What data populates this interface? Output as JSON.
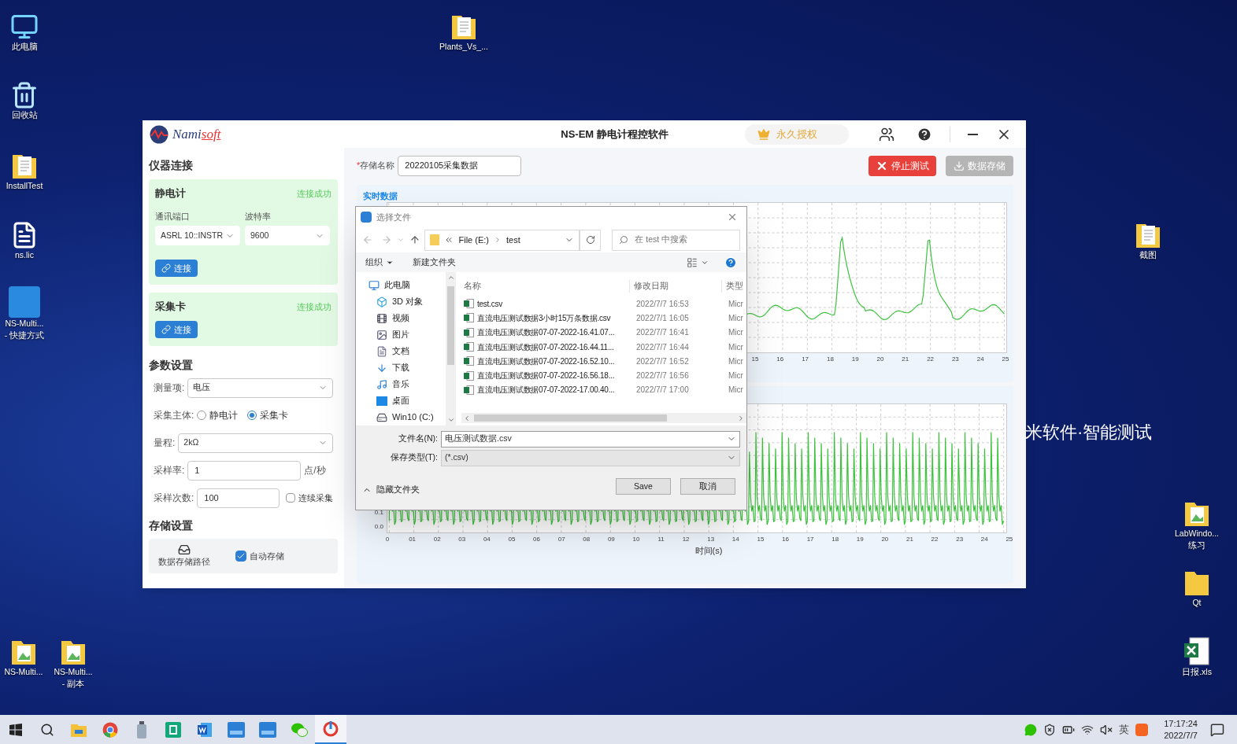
{
  "desktop": {
    "wallpaper_text": "米软件·智能测试",
    "icons": [
      {
        "kind": "computer",
        "lines": [
          "此电脑"
        ]
      },
      {
        "kind": "recycle-bin",
        "lines": [
          "回收站"
        ]
      },
      {
        "kind": "folder-doc",
        "lines": [
          "InstallTest"
        ]
      },
      {
        "kind": "document",
        "lines": [
          "ns.lic"
        ]
      },
      {
        "kind": "meter-app",
        "lines": [
          "NS-Multi...",
          "- 快捷方式"
        ]
      },
      {
        "kind": "folder-image",
        "lines": [
          "NS-Multi..."
        ]
      },
      {
        "kind": "folder-image",
        "lines": [
          "NS-Multi...",
          "- 副本"
        ]
      },
      {
        "kind": "folder-doc",
        "lines": [
          "Plants_Vs_..."
        ]
      },
      {
        "kind": "folder-doc",
        "lines": [
          "截图"
        ]
      },
      {
        "kind": "folder-image",
        "lines": [
          "LabWindo...",
          "练习"
        ]
      },
      {
        "kind": "folder",
        "lines": [
          "Qt"
        ]
      },
      {
        "kind": "excel",
        "lines": [
          "日报.xls"
        ]
      }
    ]
  },
  "app": {
    "logo": {
      "primary": "Nami",
      "accent": "soft"
    },
    "title": "NS-EM 静电计程控软件",
    "license": "永久授权",
    "sidebar": {
      "connection": {
        "heading": "仪器连接",
        "devices": [
          {
            "name": "静电计",
            "status": "连接成功",
            "connected": true,
            "fields": [
              {
                "label": "通讯端口",
                "value": "ASRL 10::INSTR"
              },
              {
                "label": "波特率",
                "value": "9600"
              }
            ],
            "button": "连接"
          },
          {
            "name": "采集卡",
            "status": "连接成功",
            "connected": true,
            "button": "连接"
          }
        ]
      },
      "params": {
        "heading": "参数设置",
        "rows": [
          {
            "kind": "select",
            "label": "测量项:",
            "value": "电压"
          },
          {
            "kind": "radio",
            "label": "采集主体:",
            "options": [
              {
                "label": "静电计",
                "selected": false
              },
              {
                "label": "采集卡",
                "selected": true
              }
            ]
          },
          {
            "kind": "select",
            "label": "量程:",
            "value": "2kΩ"
          },
          {
            "kind": "input",
            "label": "采样率:",
            "value": "1",
            "suffix": "点/秒"
          },
          {
            "kind": "input-check",
            "label": "采样次数:",
            "value": "100",
            "check": {
              "label": "连续采集",
              "checked": false
            }
          }
        ]
      },
      "storage": {
        "heading": "存储设置",
        "path_button": "数据存储路径",
        "auto": {
          "label": "自动存储",
          "checked": true
        }
      }
    },
    "main": {
      "name_field": {
        "required_mark": "*",
        "label": "存储名称",
        "value": "20220105采集数据"
      },
      "buttons": [
        {
          "kind": "stop",
          "label": "停止测试",
          "disabled": false
        },
        {
          "kind": "save",
          "label": "数据存储",
          "disabled": true
        }
      ],
      "charts": [
        {
          "title": "实时数据",
          "kind": "peaks",
          "x_tick_labels": [
            "15",
            "16",
            "17",
            "18",
            "19",
            "20",
            "21",
            "22",
            "23",
            "24",
            "25"
          ]
        },
        {
          "kind": "pulses",
          "x_tick_labels": [
            "0",
            "01",
            "02",
            "03",
            "04",
            "05",
            "06",
            "07",
            "08",
            "09",
            "10",
            "11",
            "12",
            "13",
            "14",
            "15",
            "16",
            "17",
            "18",
            "19",
            "20",
            "21",
            "22",
            "23",
            "24",
            "25"
          ],
          "y_tick_labels": [
            "0.1",
            "0.0"
          ],
          "xlabel": "时间(s)"
        }
      ]
    }
  },
  "dialog": {
    "title": "选择文件",
    "path": [
      "File (E:)",
      "test"
    ],
    "search_placeholder": "在 test 中搜索",
    "toolbar": [
      "组织",
      "新建文件夹"
    ],
    "tree": [
      {
        "label": "此电脑",
        "kind": "computer",
        "children": [
          {
            "label": "3D 对象",
            "kind": "cube"
          },
          {
            "label": "视频",
            "kind": "video"
          },
          {
            "label": "图片",
            "kind": "image"
          },
          {
            "label": "文档",
            "kind": "document"
          },
          {
            "label": "下载",
            "kind": "download"
          },
          {
            "label": "音乐",
            "kind": "music"
          },
          {
            "label": "桌面",
            "kind": "desktop"
          },
          {
            "label": "Win10 (C:)",
            "kind": "drive"
          }
        ]
      }
    ],
    "columns": [
      "名称",
      "修改日期",
      "类型"
    ],
    "files": [
      {
        "name": "test.csv",
        "date": "2022/7/7 16:53",
        "type": "Micr"
      },
      {
        "name": "直流电压测试数据3小时15万条数据.csv",
        "date": "2022/7/1 16:05",
        "type": "Micr"
      },
      {
        "name": "直流电压测试数据07-07-2022-16.41.07...",
        "date": "2022/7/7 16:41",
        "type": "Micr"
      },
      {
        "name": "直流电压测试数据07-07-2022-16.44.11...",
        "date": "2022/7/7 16:44",
        "type": "Micr"
      },
      {
        "name": "直流电压测试数据07-07-2022-16.52.10...",
        "date": "2022/7/7 16:52",
        "type": "Micr"
      },
      {
        "name": "直流电压测试数据07-07-2022-16.56.18...",
        "date": "2022/7/7 16:56",
        "type": "Micr"
      },
      {
        "name": "直流电压测试数据07-07-2022-17.00.40...",
        "date": "2022/7/7 17:00",
        "type": "Micr"
      }
    ],
    "filename": {
      "label": "文件名(N):",
      "value": "电压测试数据.csv"
    },
    "filetype": {
      "label": "保存类型(T):",
      "value": "(*.csv)"
    },
    "hide_folders": "隐藏文件夹",
    "buttons": [
      "Save",
      "取消"
    ]
  },
  "taskbar": {
    "items": [
      {
        "kind": "start",
        "active": false
      },
      {
        "kind": "search",
        "active": false
      },
      {
        "kind": "explorer",
        "active": false
      },
      {
        "kind": "chrome",
        "active": false
      },
      {
        "kind": "bottle",
        "active": false
      },
      {
        "kind": "green-app",
        "active": false
      },
      {
        "kind": "word",
        "active": false
      },
      {
        "kind": "meter",
        "active": false
      },
      {
        "kind": "meter",
        "active": false
      },
      {
        "kind": "wechat",
        "active": false
      },
      {
        "kind": "ns-app",
        "active": true
      }
    ],
    "tray": [
      {
        "kind": "wechat"
      },
      {
        "kind": "shield"
      },
      {
        "kind": "battery"
      },
      {
        "kind": "wifi"
      },
      {
        "kind": "mute"
      },
      {
        "kind": "ime",
        "text": "英"
      },
      {
        "kind": "sogou"
      }
    ],
    "time": "17:17:24",
    "date": "2022/7/7"
  }
}
